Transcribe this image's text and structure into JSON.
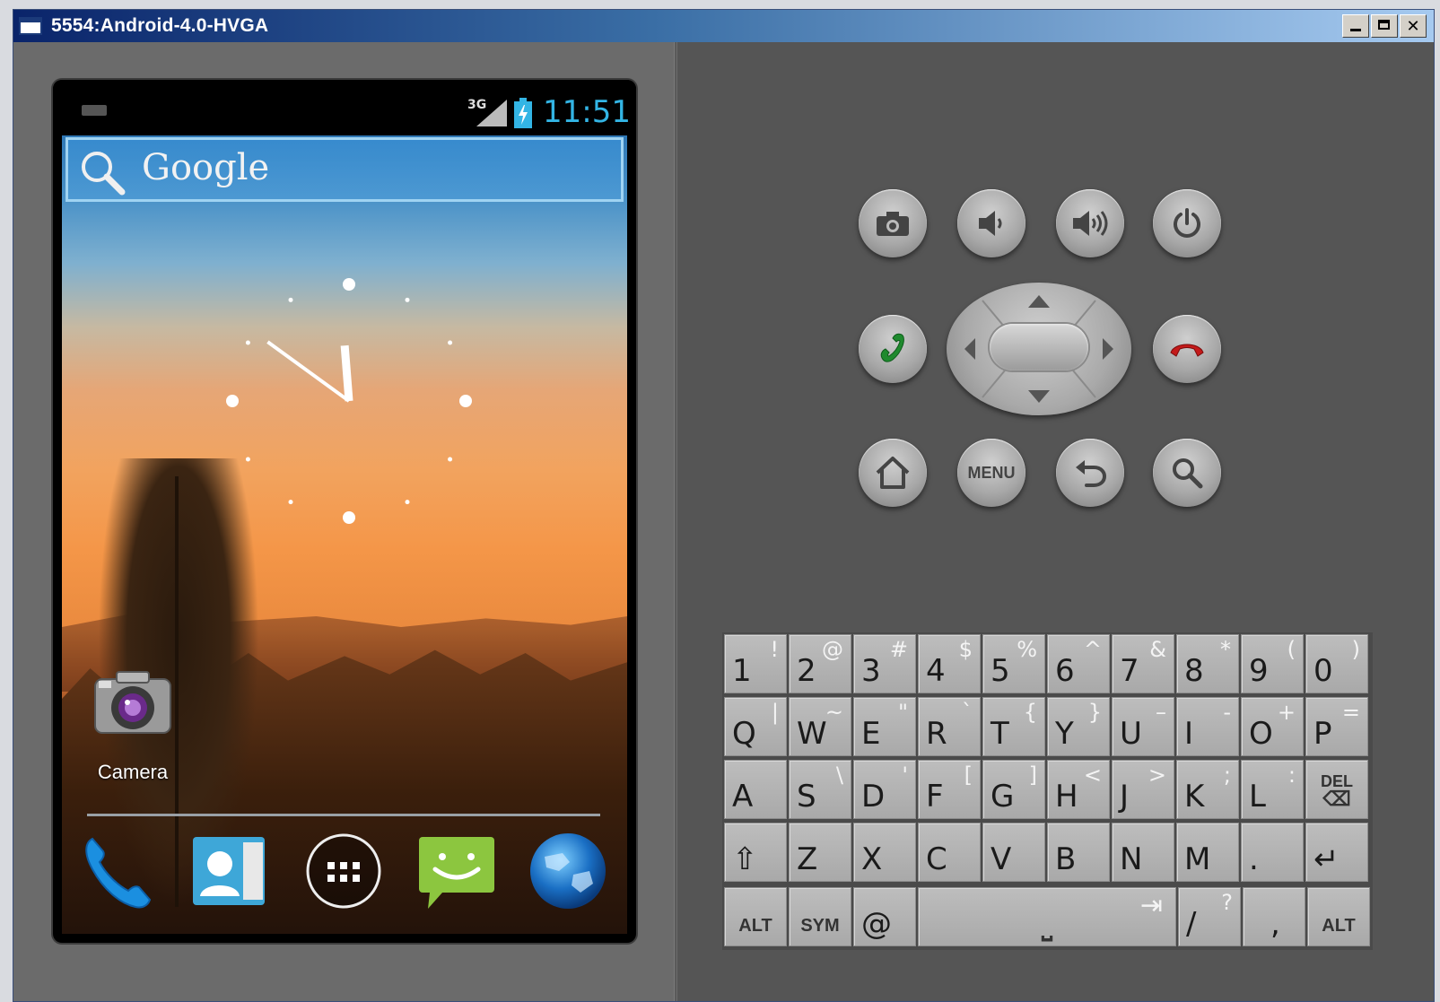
{
  "window": {
    "title": "5554:Android-4.0-HVGA",
    "min_label": "",
    "max_label": "",
    "close_label": "✕"
  },
  "status_bar": {
    "network": "3G",
    "time": "11:51"
  },
  "search_widget": {
    "brand": "Google"
  },
  "analog_clock": {
    "hour": 11,
    "minute": 51
  },
  "home_apps": [
    {
      "label": "Camera",
      "icon": "camera-icon"
    }
  ],
  "dock": [
    {
      "icon": "phone-icon"
    },
    {
      "icon": "contacts-icon"
    },
    {
      "icon": "all-apps-icon"
    },
    {
      "icon": "messaging-icon"
    },
    {
      "icon": "browser-icon"
    }
  ],
  "hardware_buttons": {
    "camera": "camera-icon",
    "volume_down": "volume-down-icon",
    "volume_up": "volume-up-icon",
    "power": "power-icon",
    "call": "call-icon",
    "end_call": "end-call-icon",
    "home": "home-icon",
    "menu_label": "MENU",
    "back": "back-icon",
    "search": "search-icon"
  },
  "keyboard": {
    "rows": [
      [
        {
          "m": "1",
          "a": "!"
        },
        {
          "m": "2",
          "a": "@"
        },
        {
          "m": "3",
          "a": "#"
        },
        {
          "m": "4",
          "a": "$"
        },
        {
          "m": "5",
          "a": "%"
        },
        {
          "m": "6",
          "a": "^"
        },
        {
          "m": "7",
          "a": "&"
        },
        {
          "m": "8",
          "a": "*"
        },
        {
          "m": "9",
          "a": "("
        },
        {
          "m": "0",
          "a": ")"
        }
      ],
      [
        {
          "m": "Q",
          "a": "|"
        },
        {
          "m": "W",
          "a": "~"
        },
        {
          "m": "E",
          "a": "\""
        },
        {
          "m": "R",
          "a": "`"
        },
        {
          "m": "T",
          "a": "{"
        },
        {
          "m": "Y",
          "a": "}"
        },
        {
          "m": "U",
          "a": "–"
        },
        {
          "m": "I",
          "a": "-"
        },
        {
          "m": "O",
          "a": "+"
        },
        {
          "m": "P",
          "a": "="
        }
      ],
      [
        {
          "m": "A",
          "a": ""
        },
        {
          "m": "S",
          "a": "\\"
        },
        {
          "m": "D",
          "a": "'"
        },
        {
          "m": "F",
          "a": "["
        },
        {
          "m": "G",
          "a": "]"
        },
        {
          "m": "H",
          "a": "<"
        },
        {
          "m": "J",
          "a": ">"
        },
        {
          "m": "K",
          "a": ";"
        },
        {
          "m": "L",
          "a": ":"
        },
        {
          "m": "",
          "a": "",
          "s": "DEL"
        }
      ],
      [
        {
          "m": "⇧",
          "a": ""
        },
        {
          "m": "Z",
          "a": ""
        },
        {
          "m": "X",
          "a": ""
        },
        {
          "m": "C",
          "a": ""
        },
        {
          "m": "V",
          "a": ""
        },
        {
          "m": "B",
          "a": ""
        },
        {
          "m": "N",
          "a": ""
        },
        {
          "m": "M",
          "a": ""
        },
        {
          "m": ".",
          "a": ""
        },
        {
          "m": "↵",
          "a": ""
        }
      ]
    ],
    "bottom_row": {
      "alt_left": "ALT",
      "sym": "SYM",
      "at": "@",
      "space": "⎵",
      "tab": "⇥",
      "slash": "/",
      "question": "?",
      "comma": ",",
      "alt_right": "ALT"
    }
  }
}
